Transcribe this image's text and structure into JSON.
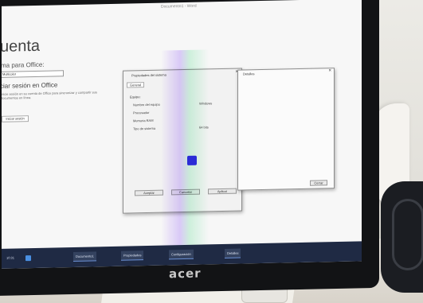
{
  "office": {
    "window_title": "Documento1 - Word",
    "page_title": "uenta",
    "theme_label": "ma para Office:",
    "theme_value": "Multicolor",
    "sessions_title": "ciar sesión en Office",
    "sessions_desc": "Inicie sesión en su cuenta de Office para sincronizar y compartir sus documentos en línea.",
    "sessions_button": "Iniciar sesión"
  },
  "system_dialog": {
    "title": "Propiedades del sistema",
    "tabs": [
      "General"
    ],
    "section": "Equipo:",
    "rows": [
      {
        "label": "Nombre del equipo",
        "value": "Windows"
      },
      {
        "label": "Procesador",
        "value": ""
      },
      {
        "label": "Memoria RAM",
        "value": ""
      },
      {
        "label": "Tipo de sistema",
        "value": "64 bits"
      }
    ],
    "buttons": [
      "Aceptar",
      "Cancelar",
      "Aplicar"
    ]
  },
  "details_dialog": {
    "title": "Detalles",
    "close_label": "×",
    "button": "Cerrar"
  },
  "taskbar": {
    "time": "10:31",
    "items": [
      "Documento1",
      "Propiedades",
      "Configuración",
      "Detalles"
    ]
  },
  "monitor": {
    "brand": "acer"
  },
  "colors": {
    "taskbar": "#1f2a44",
    "accent": "#2b2bd6"
  }
}
